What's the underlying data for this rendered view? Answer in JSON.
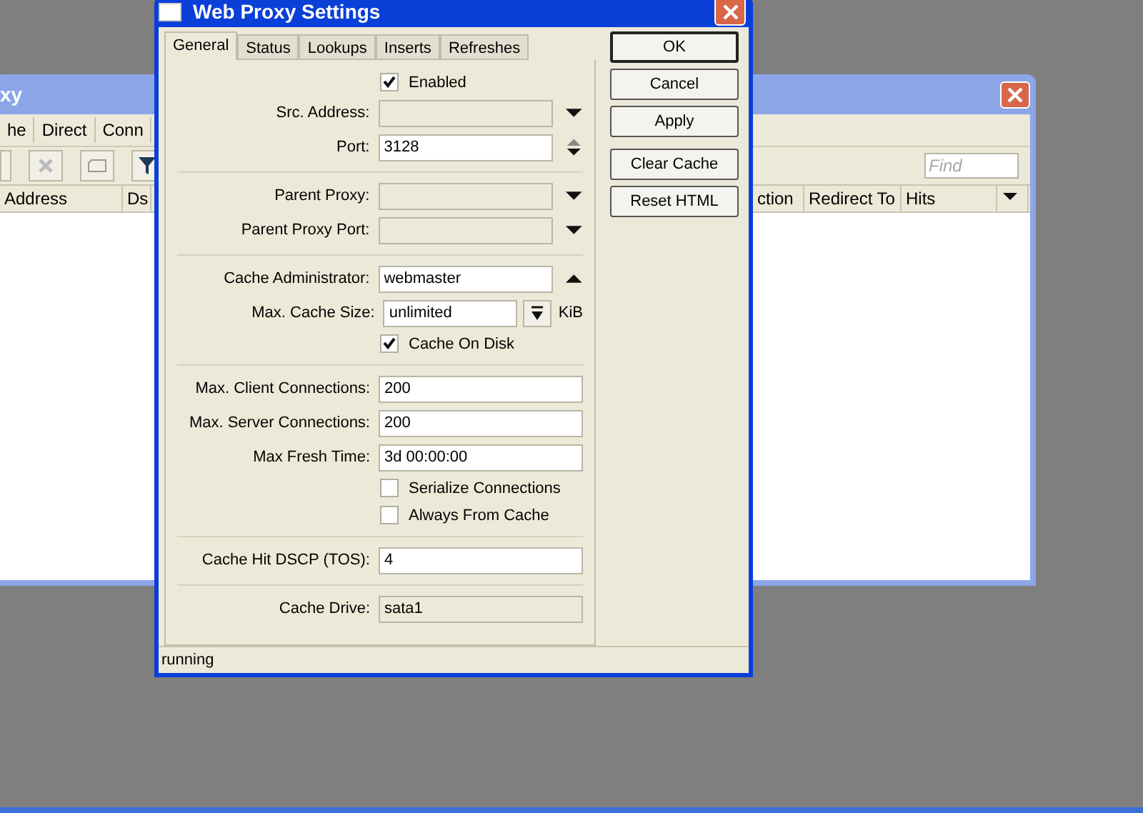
{
  "back_window": {
    "title": "xy",
    "menu": [
      "he",
      "Direct",
      "Conn"
    ],
    "find": {
      "placeholder": "Find"
    },
    "columns_left": [
      "Address",
      "Ds"
    ],
    "columns_right": [
      "ction",
      "Redirect To",
      "Hits"
    ]
  },
  "dialog": {
    "title": "Web Proxy Settings",
    "tabs": [
      {
        "label": "General",
        "selected": true
      },
      {
        "label": "Status",
        "selected": false
      },
      {
        "label": "Lookups",
        "selected": false
      },
      {
        "label": "Inserts",
        "selected": false
      },
      {
        "label": "Refreshes",
        "selected": false
      }
    ],
    "groups": [
      [
        {
          "kind": "checkbox",
          "label": "Enabled",
          "checked": true
        },
        {
          "kind": "field",
          "label": "Src. Address:",
          "disabled": true,
          "control": {
            "kind": "down"
          }
        },
        {
          "kind": "field",
          "label": "Port:",
          "value": "3128",
          "disabled": false,
          "control": {
            "kind": "spin"
          }
        }
      ],
      [
        {
          "kind": "field",
          "label": "Parent Proxy:",
          "disabled": true,
          "control": {
            "kind": "down"
          }
        },
        {
          "kind": "field",
          "label": "Parent Proxy Port:",
          "disabled": true,
          "control": {
            "kind": "down"
          }
        }
      ],
      [
        {
          "kind": "field",
          "label": "Cache Administrator:",
          "value": "webmaster",
          "disabled": false,
          "control": {
            "kind": "up"
          }
        },
        {
          "kind": "field",
          "label": "Max. Cache Size:",
          "value": "unlimited",
          "disabled": false,
          "control": {
            "kind": "bar"
          },
          "unit": "KiB"
        },
        {
          "kind": "checkbox",
          "label": "Cache On Disk",
          "checked": true
        }
      ],
      [
        {
          "kind": "field",
          "label": "Max. Client Connections:",
          "value": "200",
          "disabled": false
        },
        {
          "kind": "field",
          "label": "Max. Server Connections:",
          "value": "200",
          "disabled": false
        },
        {
          "kind": "field",
          "label": "Max Fresh Time:",
          "value": "3d 00:00:00",
          "disabled": false
        },
        {
          "kind": "checkbox",
          "label": "Serialize Connections",
          "checked": false
        },
        {
          "kind": "checkbox",
          "label": "Always From Cache",
          "checked": false
        }
      ],
      [
        {
          "kind": "field",
          "label": "Cache Hit DSCP (TOS):",
          "value": "4",
          "disabled": false
        }
      ],
      [
        {
          "kind": "field",
          "label": "Cache Drive:",
          "value": "sata1",
          "disabled": true
        }
      ]
    ],
    "buttons": [
      [
        "OK",
        "Cancel",
        "Apply"
      ],
      [
        "Clear Cache",
        "Reset HTML"
      ]
    ],
    "status": "running"
  }
}
